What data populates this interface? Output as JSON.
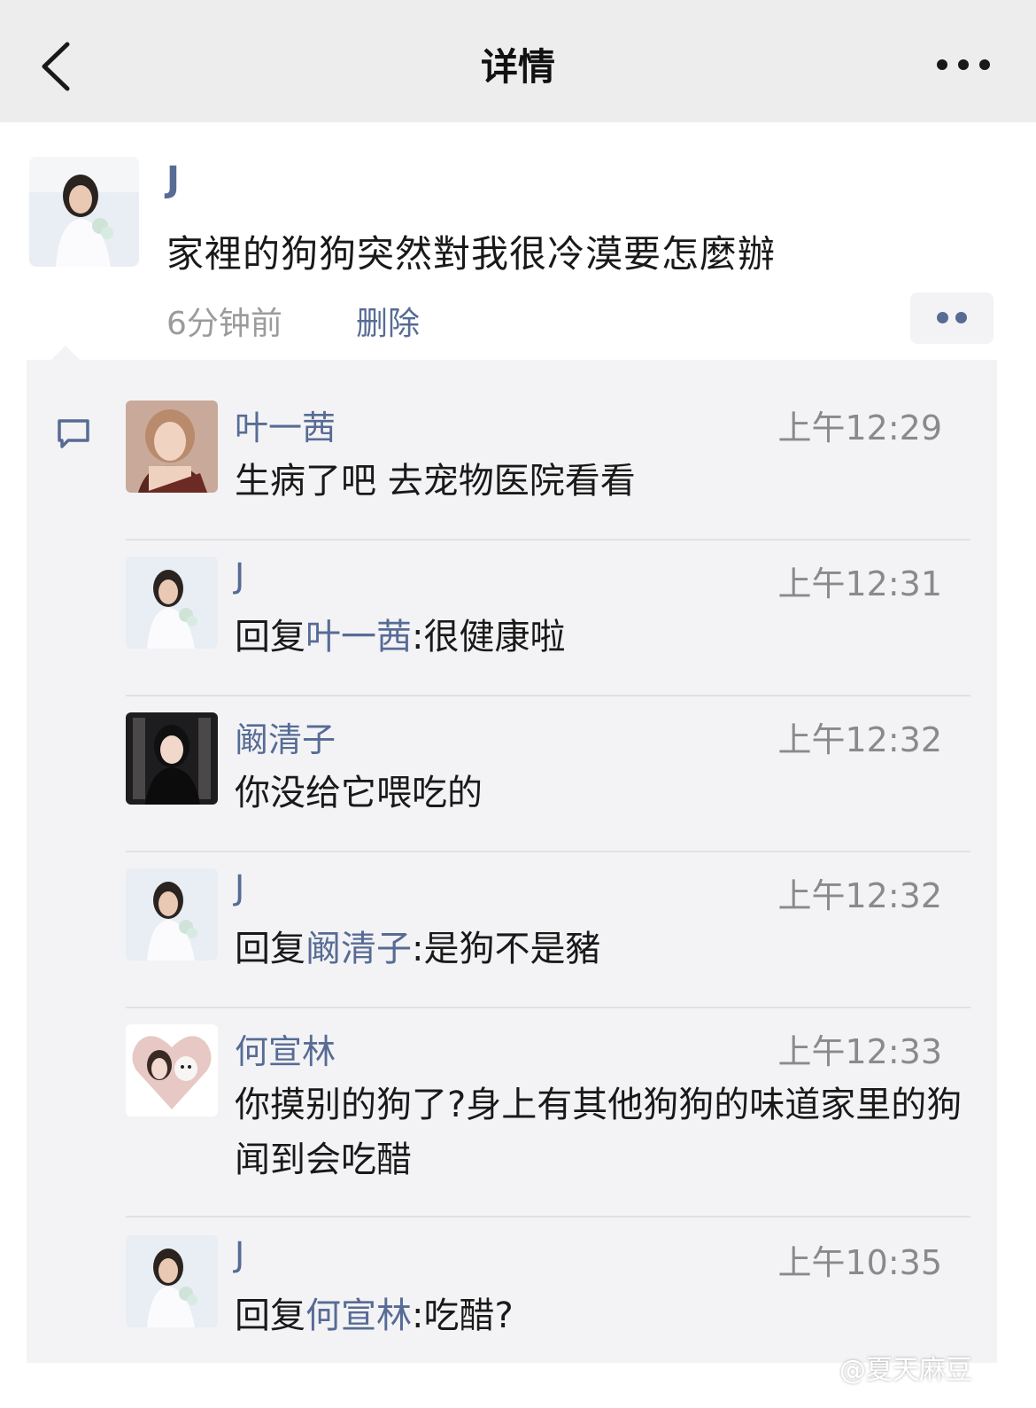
{
  "navbar": {
    "title": "详情",
    "back_icon": "chevron-left-icon",
    "more_icon": "ellipsis-icon"
  },
  "post": {
    "author": "J",
    "text": "家裡的狗狗突然對我很冷漠要怎麼辦",
    "time": "6分钟前",
    "delete_label": "删除"
  },
  "comments": [
    {
      "name": "叶一茜",
      "time": "上午12:29",
      "text": "生病了吧 去宠物医院看看"
    },
    {
      "name": "J",
      "time": "上午12:31",
      "reply_prefix": "回复",
      "reply_to": "叶一茜",
      "reply_text": ":很健康啦"
    },
    {
      "name": "阚清子",
      "time": "上午12:32",
      "text": "你没给它喂吃的"
    },
    {
      "name": "J",
      "time": "上午12:32",
      "reply_prefix": "回复",
      "reply_to": "阚清子",
      "reply_text": ":是狗不是豬"
    },
    {
      "name": "何宣林",
      "time": "上午12:33",
      "text": "你摸别的狗了?身上有其他狗狗的味道家里的狗闻到会吃醋"
    },
    {
      "name": "J",
      "time": "上午10:35",
      "reply_prefix": "回复",
      "reply_to": "何宣林",
      "reply_text": ":吃醋?"
    }
  ],
  "signature": "@夏天麻豆",
  "colors": {
    "link": "#576b95",
    "navbar_bg": "#ededed",
    "panel_bg": "#f3f3f5"
  }
}
